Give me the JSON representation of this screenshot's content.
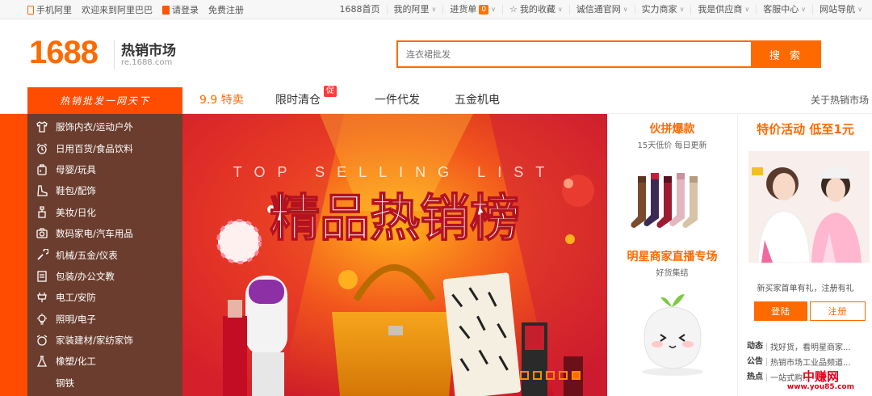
{
  "topbar": {
    "left": [
      "手机阿里",
      "欢迎来到阿里巴巴",
      "请登录",
      "免费注册"
    ],
    "right": [
      "1688首页",
      "我的阿里",
      "进货单",
      "我的收藏",
      "诚信通官网",
      "实力商家",
      "我是供应商",
      "客服中心",
      "网站导航"
    ],
    "cart_count": "0"
  },
  "header": {
    "logo": "1688",
    "title": "热销市场",
    "subtitle": "re.1688.com"
  },
  "search": {
    "placeholder": "连衣裙批发",
    "button": "搜 索"
  },
  "nav": {
    "category_label": "热销批发一网天下",
    "items": [
      "9.9 特卖",
      "限时清仓",
      "一件代发",
      "五金机电"
    ],
    "promo_badge": "促",
    "right_link": "关于热销市场"
  },
  "categories": [
    {
      "label": "服饰内衣/运动户外",
      "icon": "shirt-icon"
    },
    {
      "label": "日用百货/食品饮料",
      "icon": "alarm-clock-icon"
    },
    {
      "label": "母婴/玩具",
      "icon": "bottle-icon"
    },
    {
      "label": "鞋包/配饰",
      "icon": "boot-icon"
    },
    {
      "label": "美妆/日化",
      "icon": "lotion-icon"
    },
    {
      "label": "数码家电/汽车用品",
      "icon": "camera-icon"
    },
    {
      "label": "机械/五金/仪表",
      "icon": "wrench-icon"
    },
    {
      "label": "包装/办公文教",
      "icon": "box-icon"
    },
    {
      "label": "电工/安防",
      "icon": "plug-icon"
    },
    {
      "label": "照明/电子",
      "icon": "bulb-icon"
    },
    {
      "label": "家装建材/家纺家饰",
      "icon": "sofa-icon"
    },
    {
      "label": "橡塑/化工",
      "icon": "flask-icon"
    },
    {
      "label": "钢铁",
      "icon": ""
    }
  ],
  "banner": {
    "en_text": "TOP SELLING LIST",
    "cn_text": "精品热销榜",
    "slide_count": 5,
    "active_slide": 5
  },
  "mid": {
    "section1": {
      "title": "伙拼爆款",
      "subtitle": "15天低价 每日更新"
    },
    "section2": {
      "title": "明星商家直播专场",
      "subtitle": "好货集结"
    }
  },
  "right": {
    "title": "特价活动 低至1元",
    "welcome": "新买家首单有礼，注册有礼",
    "login": "登陆",
    "register": "注册",
    "news": [
      {
        "tag": "动态",
        "text": "找好货，看明星商家..."
      },
      {
        "tag": "公告",
        "text": "热销市场工业品频道..."
      },
      {
        "tag": "热点",
        "text": "一站式购..."
      }
    ]
  },
  "watermark": {
    "line1": "中赚网",
    "line2": "www.you85.com"
  },
  "colors": {
    "brand": "#ff6a00",
    "menu_bg": "#6b3d2e",
    "red": "#ff4c00"
  }
}
